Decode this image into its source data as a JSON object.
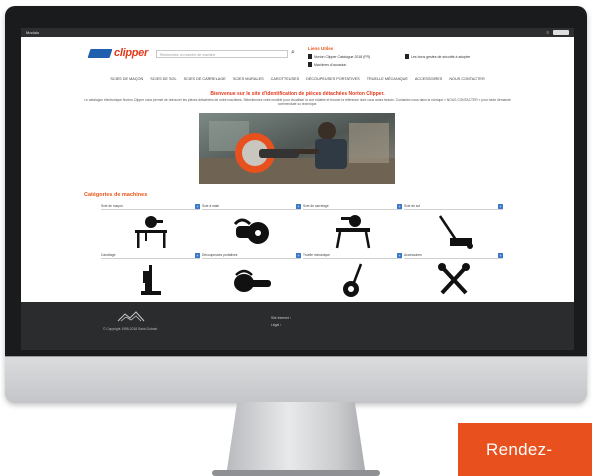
{
  "os_bar": {
    "left_label": "Modulo"
  },
  "header": {
    "brand": "clipper",
    "search_placeholder": "Recherchez un numéro de machine",
    "quick_links_title": "Liens Utiles",
    "quick_links": [
      "Norton Clipper Catalogue 2018 (FR)",
      "Machines d'occasion",
      "Les bons gestes de sécurité à adopter"
    ]
  },
  "nav": [
    "SCIES DE MAÇON",
    "SCIES DE SOL",
    "SCIES DE CARRELAGE",
    "SCIES MURALES",
    "CAROTTEUSES",
    "DÉCOUPEUSES PORTATIVES",
    "TRUELLE MÉCANIQUE",
    "ACCESSOIRES",
    "NOUS CONTACTER"
  ],
  "content": {
    "welcome": "Bienvenue sur le site d'identification de pièces détachées Norton Clipper.",
    "intro": "Le catalogue électronique Norton Clipper vous permet de retrouver les pièces détachées de notre machines. Sélectionnez votre modèle pour visualiser la vue éclatée et trouver la référence dont vous aurez besoin. Contactez nous dans la rubrique « NOUS CONTACTER » pour toute demande commerciale ou technique.",
    "categories_title": "Catégories de machines",
    "categories": [
      {
        "name": "Scie de maçon",
        "icon": "masonry-saw-icon"
      },
      {
        "name": "Scie à main",
        "icon": "cut-off-saw-icon"
      },
      {
        "name": "Scie de carrelage",
        "icon": "tile-saw-icon"
      },
      {
        "name": "Scie de sol",
        "icon": "floor-saw-icon"
      },
      {
        "name": "Carottage",
        "icon": "core-drill-icon"
      },
      {
        "name": "Découpeuses portatives",
        "icon": "chainsaw-icon"
      },
      {
        "name": "Truelle mécanique",
        "icon": "power-trowel-icon"
      },
      {
        "name": "Accessoires",
        "icon": "tools-icon"
      }
    ]
  },
  "footer": {
    "brand_lines": [
      "SAINT-GOBAIN"
    ],
    "copyright": "© Copyright 1998-2018 Saint-Gobain",
    "links": [
      "Site Internet ›",
      "Légal ›"
    ]
  },
  "cta": {
    "label": "Rendez-"
  },
  "colors": {
    "accent": "#e8511e",
    "brand_blue": "#1f5fae",
    "footer": "#2b2c2e"
  }
}
